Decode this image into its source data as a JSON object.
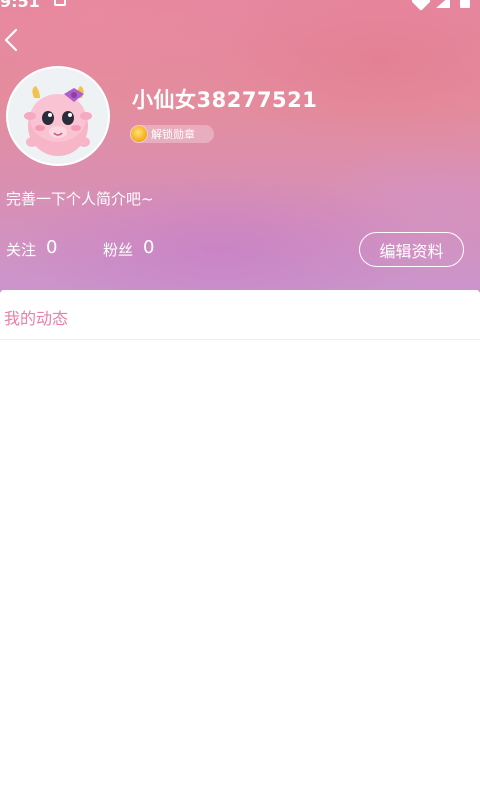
{
  "status_bar": {
    "time": "9:51"
  },
  "profile": {
    "username": "小仙女38277521",
    "badge_label": "解锁勋章",
    "bio": "完善一下个人简介吧~",
    "stats": {
      "following_label": "关注",
      "following_count": "0",
      "followers_label": "粉丝",
      "followers_count": "0"
    },
    "edit_button_label": "编辑资料"
  },
  "tabs": {
    "my_posts_label": "我的动态"
  },
  "icons": {
    "back": "chevron-left-icon",
    "badge": "medal-icon",
    "avatar": "pink-monster-avatar"
  },
  "colors": {
    "accent": "#ea7fa8",
    "header_pink": "#e6879f",
    "header_purple": "#c996cf"
  }
}
